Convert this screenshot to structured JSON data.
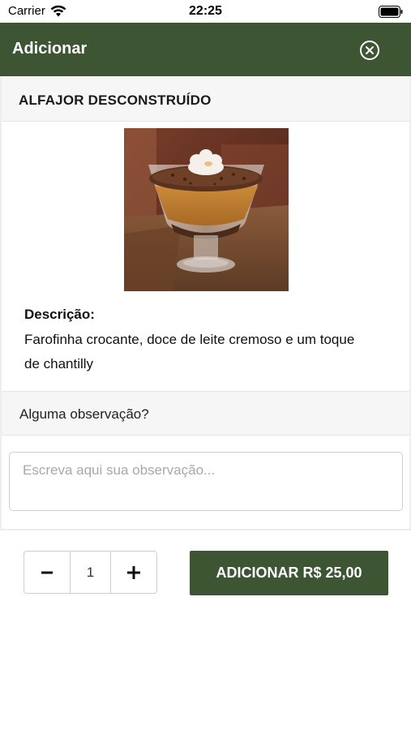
{
  "status_bar": {
    "carrier": "Carrier",
    "time": "22:25"
  },
  "header": {
    "title": "Adicionar",
    "close_icon": "close-circle-icon"
  },
  "product": {
    "name": "ALFAJOR DESCONSTRUÍDO",
    "image": "dessert-cup-photo",
    "description_label": "Descrição:",
    "description": "Farofinha crocante, doce de leite cremoso e um toque de chantilly"
  },
  "observation": {
    "label": "Alguma observação?",
    "placeholder": "Escreva aqui sua observação...",
    "value": ""
  },
  "quantity": {
    "value": "1",
    "decrement_icon": "minus-icon",
    "increment_icon": "plus-icon"
  },
  "add_button": {
    "label": "ADICIONAR R$ 25,00"
  },
  "colors": {
    "primary": "#3d5533",
    "section_bg": "#f6f6f6"
  }
}
